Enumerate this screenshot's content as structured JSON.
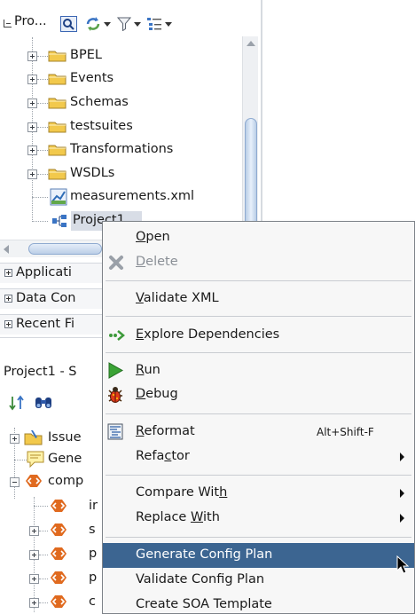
{
  "top_pane": {
    "title": "Pro...",
    "toolbar_icons": [
      "navigator-icon",
      "refresh-icon",
      "filter-icon",
      "list-options-icon"
    ],
    "tree": [
      {
        "label": "BPEL",
        "icon": "folder-icon"
      },
      {
        "label": "Events",
        "icon": "folder-icon"
      },
      {
        "label": "Schemas",
        "icon": "folder-icon"
      },
      {
        "label": "testsuites",
        "icon": "folder-icon"
      },
      {
        "label": "Transformations",
        "icon": "folder-icon"
      },
      {
        "label": "WSDLs",
        "icon": "folder-icon"
      },
      {
        "label": "measurements.xml",
        "icon": "xml-file-icon"
      },
      {
        "label": "Project1",
        "icon": "composite-icon",
        "selected": true
      }
    ]
  },
  "accordion": [
    {
      "label": "Applicati"
    },
    {
      "label": "Data Con"
    },
    {
      "label": "Recent Fi"
    }
  ],
  "structure_pane": {
    "title": "Project1 - S",
    "toolbar_icons": [
      "sort-icon",
      "binoculars-icon"
    ],
    "tree": [
      {
        "label": "Issue",
        "icon": "issues-folder-icon",
        "expander": "plus"
      },
      {
        "label": "Gene",
        "icon": "note-icon",
        "expander": "none"
      },
      {
        "label": "comp",
        "icon": "composite-diamond-icon",
        "expander": "minus"
      },
      {
        "label": "ir",
        "icon": "composite-diamond-icon",
        "expander": "none"
      },
      {
        "label": "s",
        "icon": "composite-diamond-icon",
        "expander": "plus"
      },
      {
        "label": "p",
        "icon": "composite-diamond-icon",
        "expander": "plus"
      },
      {
        "label": "p",
        "icon": "composite-diamond-icon",
        "expander": "plus"
      },
      {
        "label": "c",
        "icon": "composite-diamond-icon",
        "expander": "plus"
      }
    ]
  },
  "context_menu": {
    "items": [
      {
        "pre": "",
        "ul": "O",
        "post": "pen",
        "icon": "",
        "disabled": false
      },
      {
        "pre": "",
        "ul": "D",
        "post": "elete",
        "icon": "delete-x-icon",
        "disabled": true
      },
      {
        "pre": "",
        "ul": "V",
        "post": "alidate XML",
        "icon": ""
      },
      {
        "pre": "",
        "ul": "E",
        "post": "xplore Dependencies",
        "icon": "dependencies-icon"
      },
      {
        "pre": "",
        "ul": "R",
        "post": "un",
        "icon": "run-icon"
      },
      {
        "pre": "",
        "ul": "D",
        "post": "ebug",
        "icon": "debug-icon"
      },
      {
        "pre": "",
        "ul": "R",
        "post": "eformat",
        "icon": "reformat-icon",
        "shortcut": "Alt+Shift-F"
      },
      {
        "pre": "Refa",
        "ul": "c",
        "post": "tor",
        "icon": "",
        "submenu": true
      },
      {
        "pre": "Compare Wit",
        "ul": "h",
        "post": "",
        "icon": "",
        "submenu": true
      },
      {
        "pre": "Replace ",
        "ul": "W",
        "post": "ith",
        "icon": "",
        "submenu": true
      },
      {
        "pre": "Generate Config Plan",
        "ul": "",
        "post": "",
        "icon": "",
        "highlighted": true
      },
      {
        "pre": "Validate Config Plan",
        "ul": "",
        "post": "",
        "icon": ""
      },
      {
        "pre": "Create SOA Template",
        "ul": "",
        "post": "",
        "icon": ""
      }
    ]
  },
  "colors": {
    "menu_highlight": "#3c6591",
    "folder": "#f2c94c",
    "selection": "#d8dde6"
  }
}
